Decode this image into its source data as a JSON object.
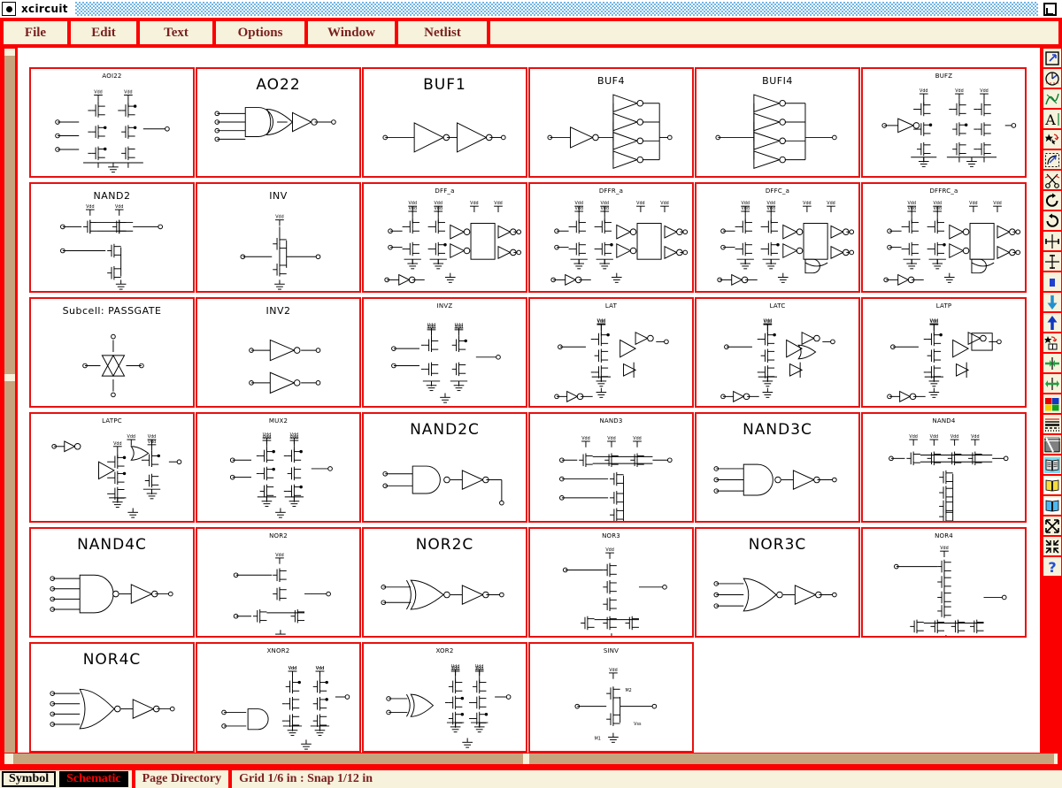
{
  "window": {
    "title": "xcircuit",
    "menu_icon": "window-menu-icon",
    "restore_icon": "restore-window-icon"
  },
  "menubar": {
    "items": [
      {
        "label": "File",
        "name": "menu-file"
      },
      {
        "label": "Edit",
        "name": "menu-edit"
      },
      {
        "label": "Text",
        "name": "menu-text"
      },
      {
        "label": "Options",
        "name": "menu-options"
      },
      {
        "label": "Window",
        "name": "menu-window"
      },
      {
        "label": "Netlist",
        "name": "menu-netlist"
      }
    ]
  },
  "library": {
    "page_title": "Page Directory",
    "cells": [
      {
        "label": "AOI22",
        "art": "aoi22",
        "size": "small"
      },
      {
        "label": "AO22",
        "art": "ao22",
        "size": "large"
      },
      {
        "label": "BUF1",
        "art": "buf1",
        "size": "large"
      },
      {
        "label": "BUF4",
        "art": "buf4",
        "size": "med"
      },
      {
        "label": "BUFI4",
        "art": "bufi4",
        "size": "med"
      },
      {
        "label": "BUFZ",
        "art": "bufz",
        "size": "small"
      },
      {
        "label": "NAND2",
        "art": "nand2t",
        "size": "med"
      },
      {
        "label": "INV",
        "art": "invt",
        "size": "med"
      },
      {
        "label": "DFF_a",
        "art": "dff",
        "size": "small"
      },
      {
        "label": "DFFR_a",
        "art": "dff",
        "size": "small"
      },
      {
        "label": "DFFC_a",
        "art": "dffc",
        "size": "small"
      },
      {
        "label": "DFFRC_a",
        "art": "dffc",
        "size": "small"
      },
      {
        "label": "Subcell:  PASSGATE",
        "art": "passgate",
        "size": "med"
      },
      {
        "label": "INV2",
        "art": "inv2",
        "size": "med"
      },
      {
        "label": "INVZ",
        "art": "invz",
        "size": "small"
      },
      {
        "label": "LAT",
        "art": "lat",
        "size": "small"
      },
      {
        "label": "LATC",
        "art": "latc",
        "size": "small"
      },
      {
        "label": "LATP",
        "art": "latp",
        "size": "small"
      },
      {
        "label": "LATPC",
        "art": "latpc",
        "size": "small"
      },
      {
        "label": "MUX2",
        "art": "mux2",
        "size": "small"
      },
      {
        "label": "NAND2C",
        "art": "nand2c",
        "size": "large"
      },
      {
        "label": "NAND3",
        "art": "nand3t",
        "size": "small"
      },
      {
        "label": "NAND3C",
        "art": "nand3c",
        "size": "large"
      },
      {
        "label": "NAND4",
        "art": "nand4t",
        "size": "small"
      },
      {
        "label": "NAND4C",
        "art": "nand4c",
        "size": "large"
      },
      {
        "label": "NOR2",
        "art": "nor2t",
        "size": "small"
      },
      {
        "label": "NOR2C",
        "art": "nor2c",
        "size": "large"
      },
      {
        "label": "NOR3",
        "art": "nor3t",
        "size": "small"
      },
      {
        "label": "NOR3C",
        "art": "nor3c",
        "size": "large"
      },
      {
        "label": "NOR4",
        "art": "nor4t",
        "size": "small"
      },
      {
        "label": "NOR4C",
        "art": "nor4c",
        "size": "large"
      },
      {
        "label": "XNOR2",
        "art": "xnor2",
        "size": "small"
      },
      {
        "label": "XOR2",
        "art": "xor2",
        "size": "small"
      },
      {
        "label": "SINV",
        "art": "sinv",
        "size": "small"
      }
    ]
  },
  "toolbar": {
    "items": [
      {
        "name": "pan-zoom-box-icon",
        "icon": "zoom-box"
      },
      {
        "name": "pan-icon",
        "icon": "pan"
      },
      {
        "name": "draw-wire-icon",
        "icon": "wire"
      },
      {
        "name": "text-label-icon",
        "icon": "text"
      },
      {
        "name": "copy-object-icon",
        "icon": "copy"
      },
      {
        "name": "edit-path-icon",
        "icon": "edit-path"
      },
      {
        "name": "delete-cut-icon",
        "icon": "scissors"
      },
      {
        "name": "rotate-cw-icon",
        "icon": "rotate-cw"
      },
      {
        "name": "rotate-ccw-icon",
        "icon": "rotate-ccw"
      },
      {
        "name": "flip-horizontal-icon",
        "icon": "flip-h"
      },
      {
        "name": "flip-vertical-icon",
        "icon": "flip-v"
      },
      {
        "name": "color-swatch-icon",
        "icon": "swatch-blue"
      },
      {
        "name": "push-down-icon",
        "icon": "arrow-down"
      },
      {
        "name": "pop-up-icon",
        "icon": "arrow-up"
      },
      {
        "name": "library-copy-icon",
        "icon": "star-book"
      },
      {
        "name": "join-icon",
        "icon": "join"
      },
      {
        "name": "unjoin-icon",
        "icon": "unjoin"
      },
      {
        "name": "color-palette-icon",
        "icon": "palette"
      },
      {
        "name": "line-style-icon",
        "icon": "linestyle"
      },
      {
        "name": "fill-style-icon",
        "icon": "fillstyle"
      },
      {
        "name": "library-page1-icon",
        "icon": "book-gray"
      },
      {
        "name": "library-page2-icon",
        "icon": "book-yellow"
      },
      {
        "name": "library-page3-icon",
        "icon": "book-blue"
      },
      {
        "name": "zoom-out-icon",
        "icon": "expand"
      },
      {
        "name": "zoom-in-icon",
        "icon": "contract"
      },
      {
        "name": "help-icon",
        "icon": "question"
      }
    ]
  },
  "statusbar": {
    "symbol_label": "Symbol",
    "schematic_label": "Schematic",
    "page_label": "Page Directory",
    "grid_label": "Grid 1/6 in : Snap 1/12 in"
  },
  "colors": {
    "frame_red": "#fb0000",
    "cell_border": "#e81010",
    "panel_cream": "#f7f2dc",
    "menu_text": "#7a2020",
    "scroll_thumb": "#c5a47e",
    "title_pattern": "#6cb4e4"
  }
}
